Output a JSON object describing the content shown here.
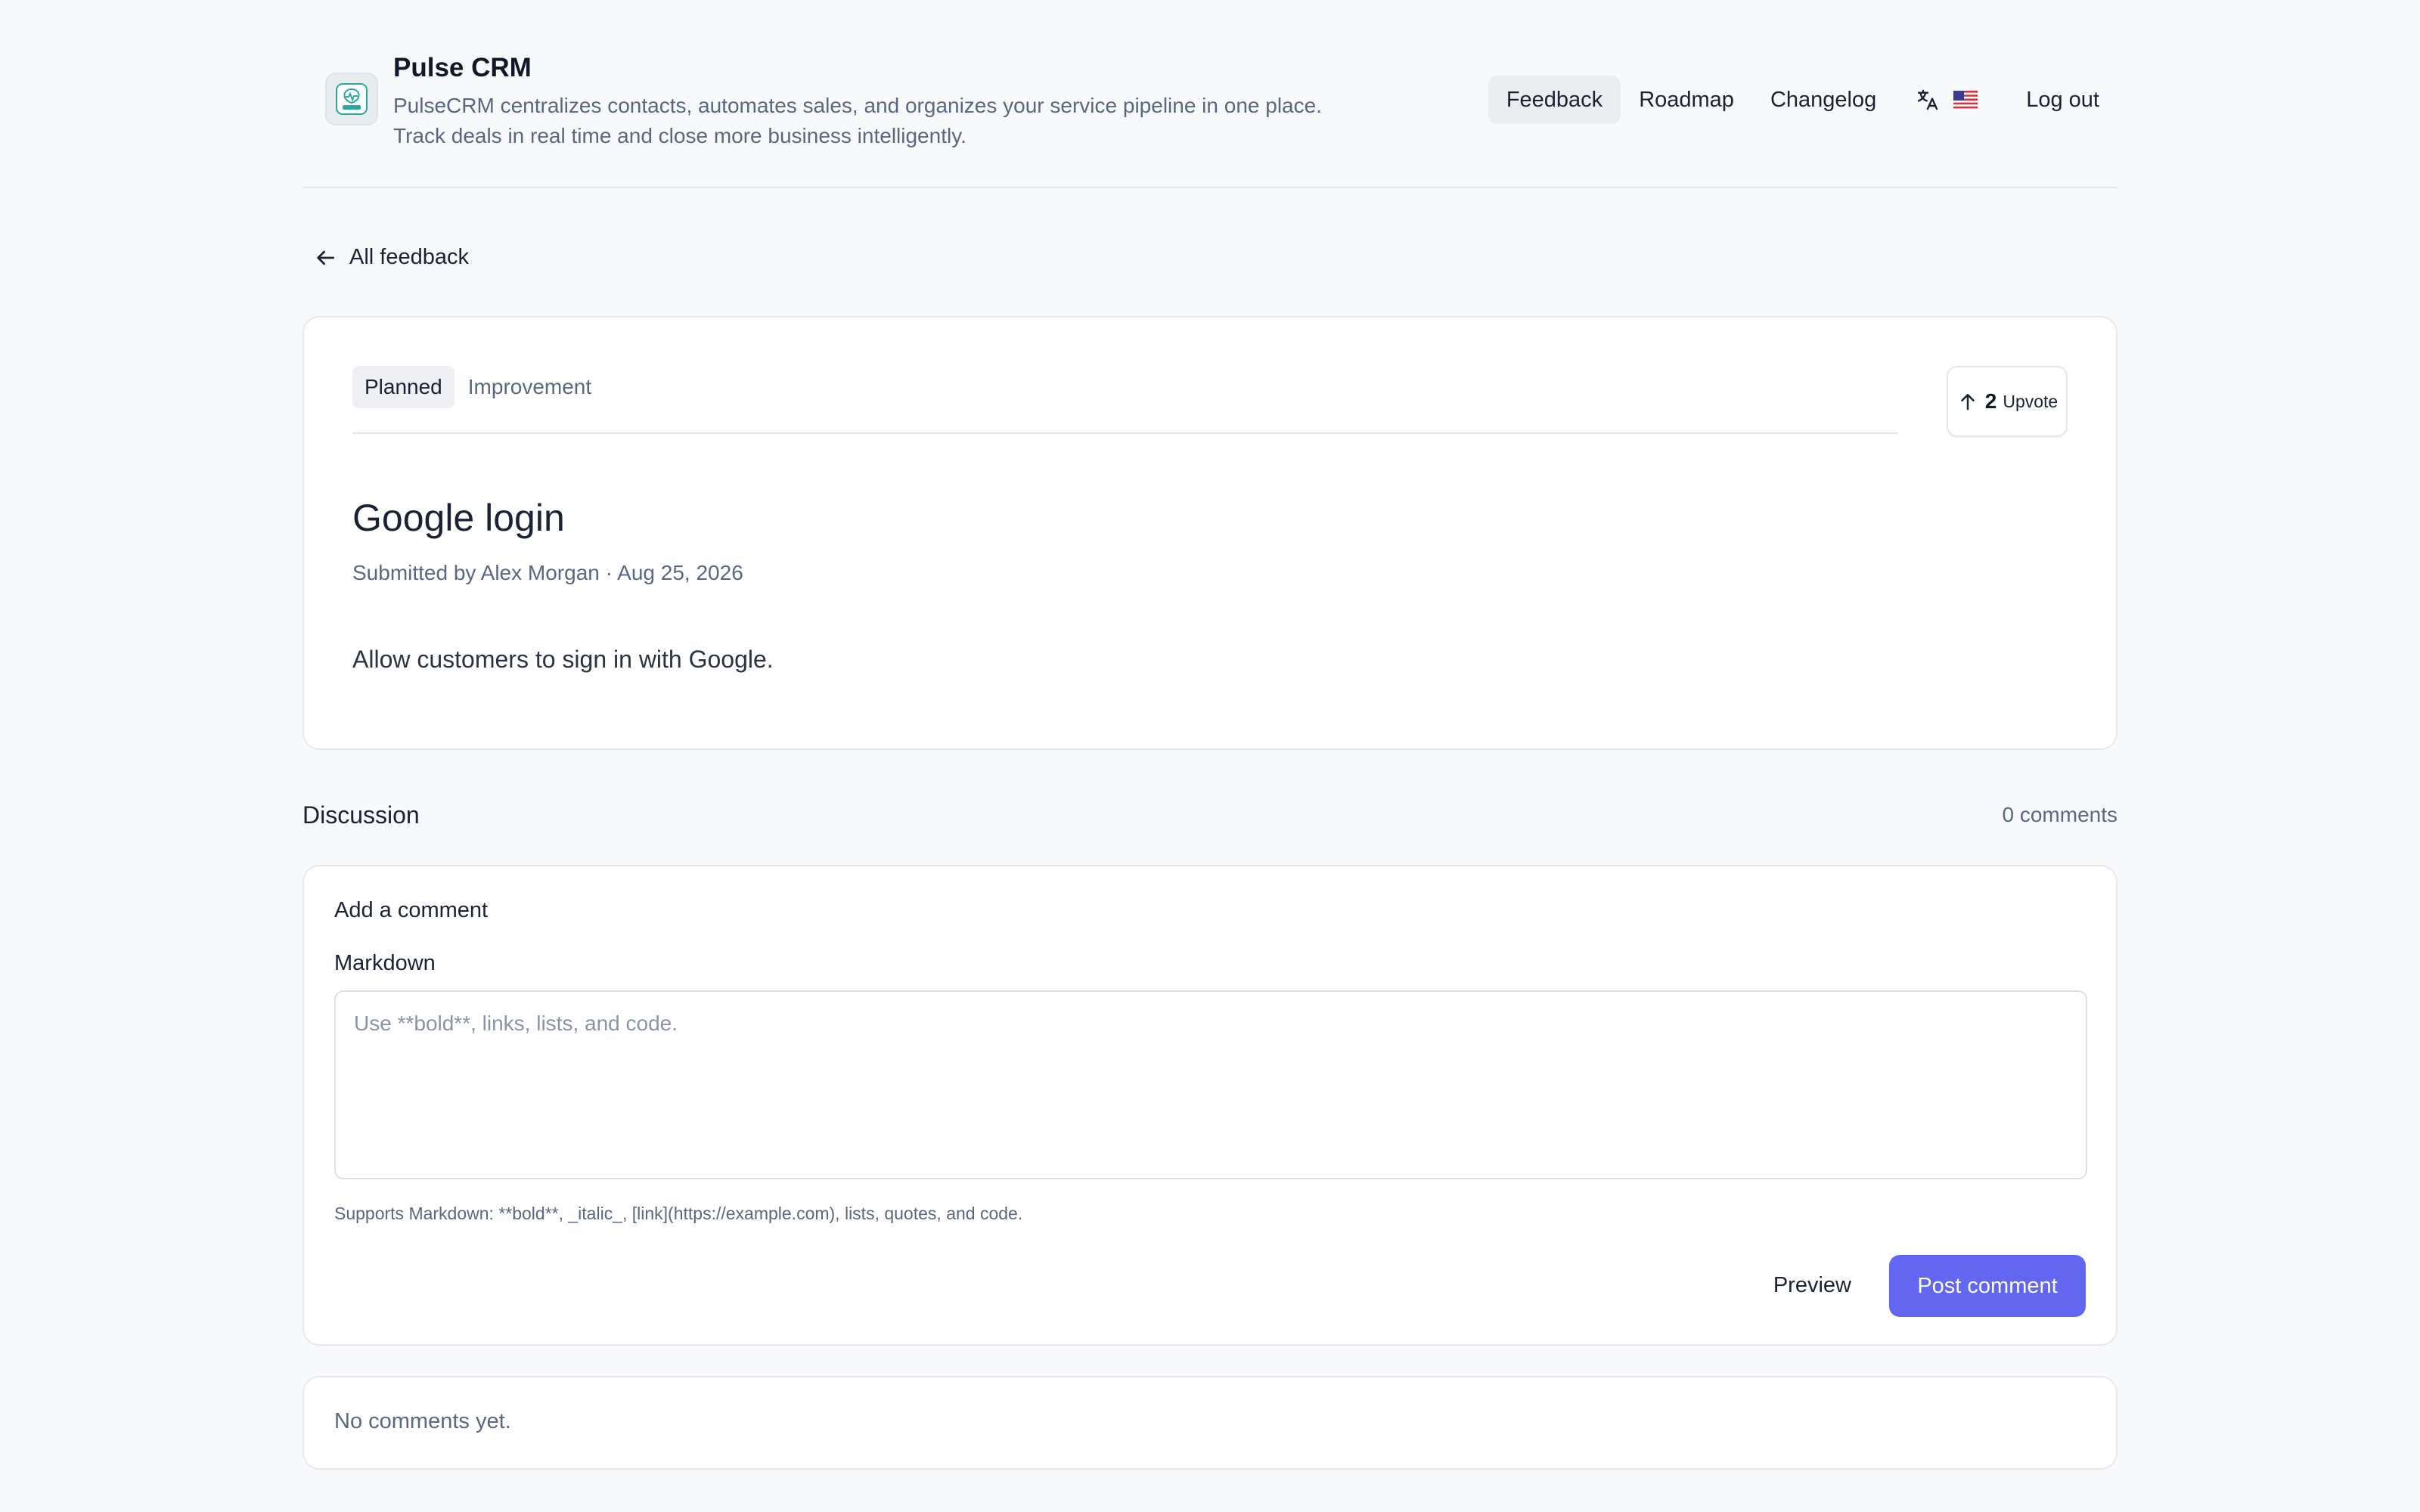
{
  "brand": {
    "name": "Pulse CRM",
    "description_line1": "PulseCRM centralizes contacts, automates sales, and organizes your service pipeline in one place.",
    "description_line2": "Track deals in real time and close more business intelligently."
  },
  "nav": {
    "items": [
      {
        "label": "Feedback",
        "active": true
      },
      {
        "label": "Roadmap",
        "active": false
      },
      {
        "label": "Changelog",
        "active": false
      }
    ],
    "language_icon": "translate-icon",
    "flag": "us-flag",
    "logout_label": "Log out"
  },
  "back_link": "All feedback",
  "post": {
    "status": "Planned",
    "category": "Improvement",
    "upvote_count": "2",
    "upvote_label": "Upvote",
    "title": "Google login",
    "meta": "Submitted by Alex Morgan · Aug 25, 2026",
    "body": "Allow customers to sign in with Google."
  },
  "discussion": {
    "title": "Discussion",
    "count": "0 comments",
    "form": {
      "heading": "Add a comment",
      "markdown_label": "Markdown",
      "placeholder": "Use **bold**, links, lists, and code.",
      "value": "",
      "help": "Supports Markdown: **bold**, _italic_, [link](https://example.com), lists, quotes, and code.",
      "preview_label": "Preview",
      "post_label": "Post comment"
    },
    "empty": "No comments yet."
  },
  "colors": {
    "accent": "#6366f1",
    "background": "#f8f9fb",
    "muted_text": "#5a6782"
  }
}
